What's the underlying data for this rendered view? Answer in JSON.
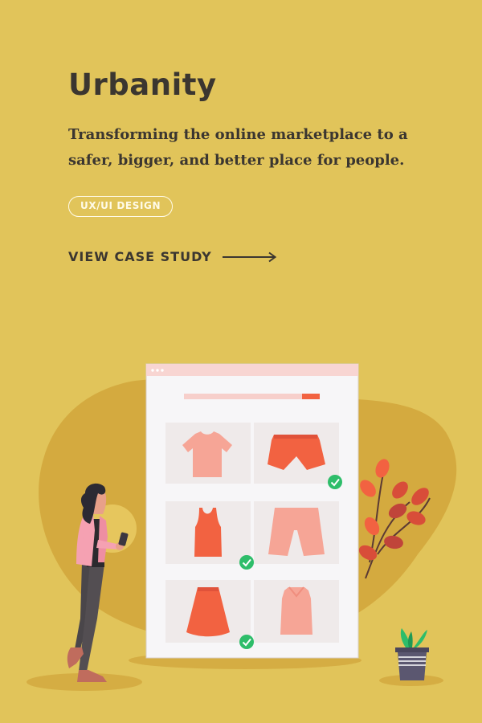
{
  "title": "Urbanity",
  "subtitle": "Transforming the online marketplace to a safer, bigger, and better place for people.",
  "tag": "UX/UI DESIGN",
  "cta": {
    "label": "VIEW CASE STUDY",
    "icon": "arrow-right-icon"
  },
  "colors": {
    "background": "#e1c45a",
    "text": "#3b3630",
    "accent_orange": "#f26241",
    "accent_pink": "#f6a596",
    "check_green": "#2ebd6a"
  },
  "illustration": {
    "browser_items": [
      {
        "name": "tshirt",
        "checked": false
      },
      {
        "name": "shorts",
        "checked": true
      },
      {
        "name": "tank-top",
        "checked": true
      },
      {
        "name": "pants",
        "checked": false
      },
      {
        "name": "skirt",
        "checked": true
      },
      {
        "name": "blouse",
        "checked": false
      }
    ],
    "search_progress": 0.87
  }
}
